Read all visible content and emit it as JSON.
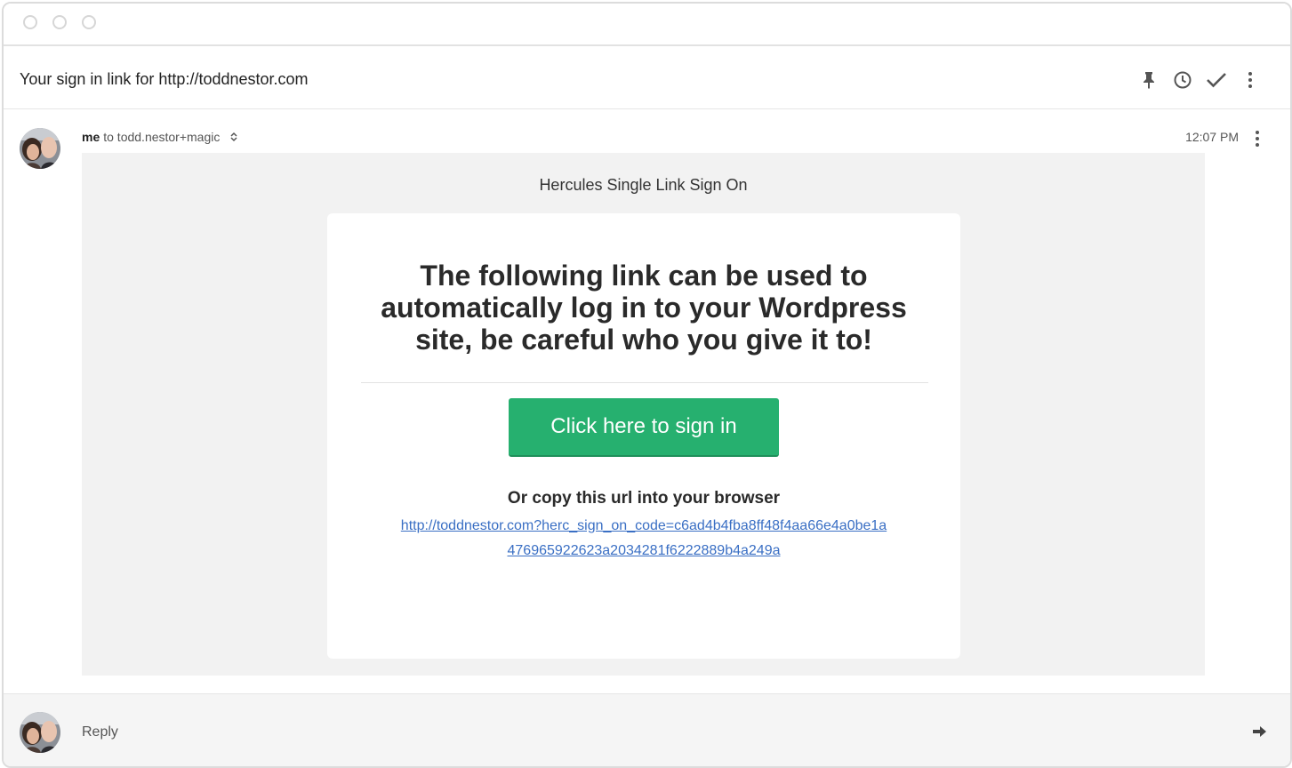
{
  "window": {
    "controls": [
      "close",
      "minimize",
      "maximize"
    ]
  },
  "subject": {
    "text": "Your sign in link for http://toddnestor.com",
    "actions": [
      "pin-icon",
      "clock-icon",
      "check-icon",
      "more-vertical-icon"
    ]
  },
  "message": {
    "sender": "me",
    "recipient": "to todd.nestor+magic",
    "time": "12:07 PM"
  },
  "email": {
    "brand": "Hercules Single Link Sign On",
    "headline": "The following link can be used to automatically log in to your Wordpress site, be careful who you give it to!",
    "button_label": "Click here to sign in",
    "copy_label": "Or copy this url into your browser",
    "url": "http://toddnestor.com?herc_sign_on_code=c6ad4b4fba8ff48f4aa66e4a0be1a476965922623a2034281f6222889b4a249a"
  },
  "reply": {
    "label": "Reply"
  },
  "colors": {
    "button": "#26b06f",
    "link": "#3a6fc4",
    "body_bg": "#f2f2f2"
  }
}
